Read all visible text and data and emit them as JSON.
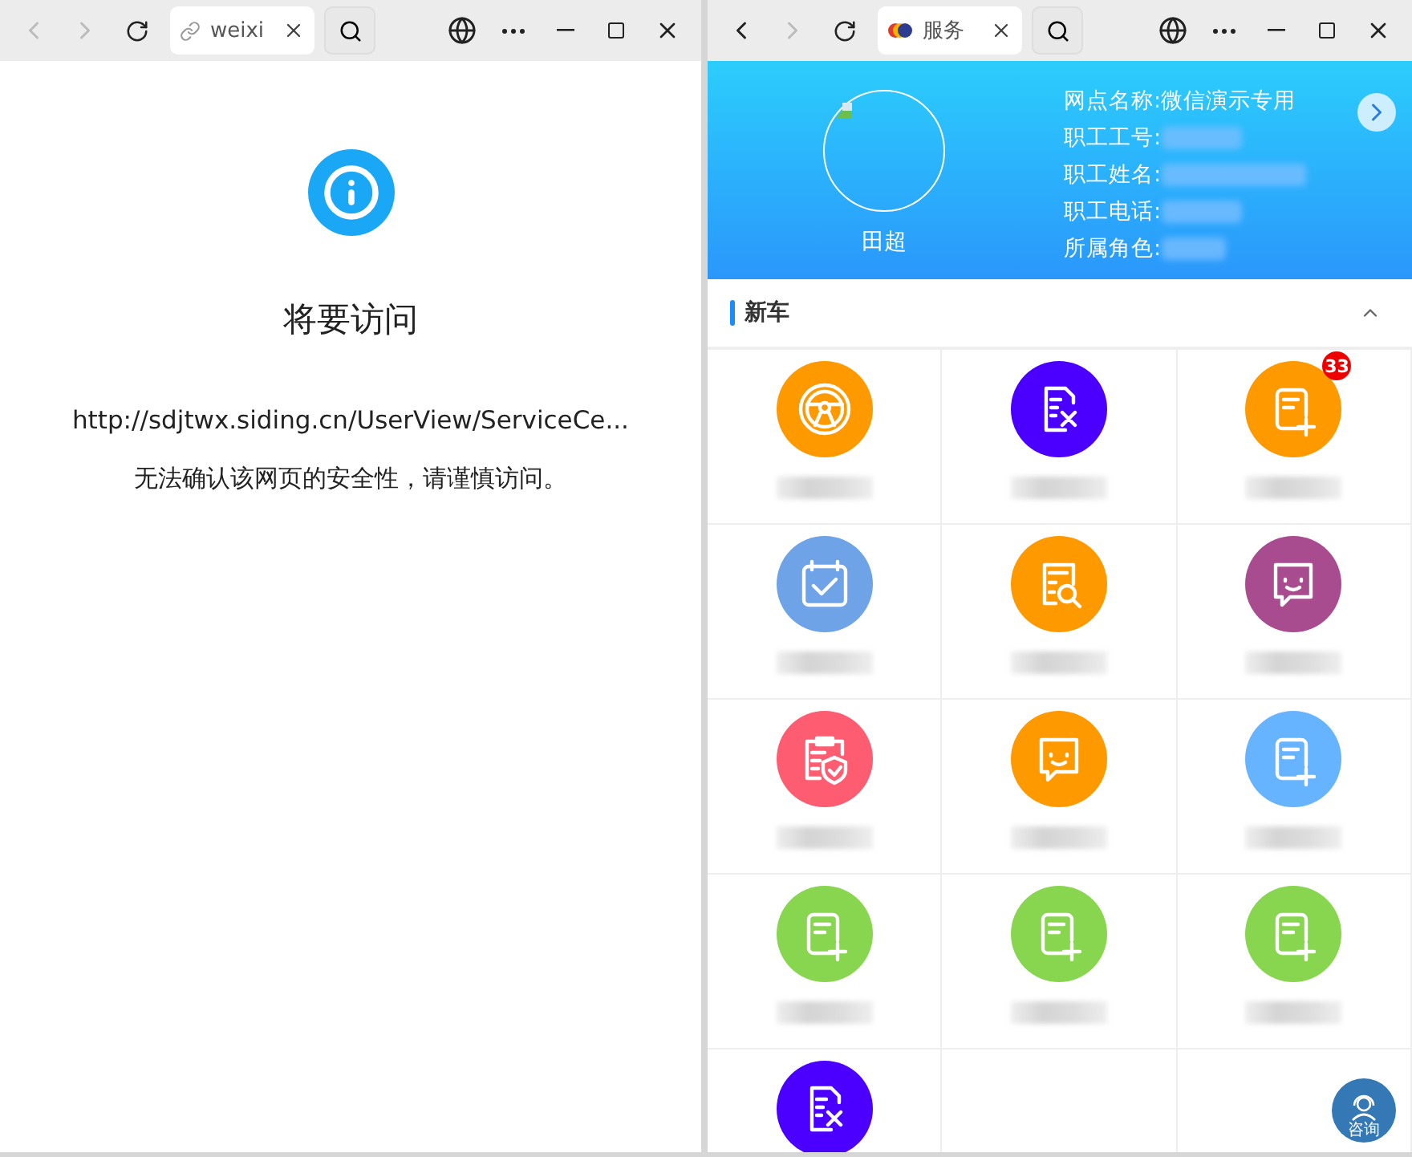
{
  "left_window": {
    "toolbar": {
      "back_enabled": false,
      "tab": {
        "title": "weixi",
        "kind": "link"
      }
    },
    "page": {
      "title": "将要访问",
      "url": "http://sdjtwx.siding.cn/UserView/ServiceCe...",
      "warning": "无法确认该网页的安全性，请谨慎访问。"
    }
  },
  "right_window": {
    "toolbar": {
      "back_enabled": true,
      "tab": {
        "title": "服务",
        "kind": "favicon"
      }
    },
    "profile": {
      "name": "田超",
      "fields": [
        {
          "label": "网点名称:",
          "value": "微信演示专用"
        },
        {
          "label": "职工工号:",
          "redacted": true
        },
        {
          "label": "职工姓名:",
          "redacted": true
        },
        {
          "label": "职工电话:",
          "redacted": true
        },
        {
          "label": "所属角色:",
          "redacted": true
        }
      ]
    },
    "section": {
      "title": "新车",
      "expanded": true
    },
    "tiles": [
      {
        "kind": "wheel",
        "color": "#ff9900",
        "blurred_label": true
      },
      {
        "kind": "doc-tools",
        "color": "#4b00ff",
        "blurred_label": true
      },
      {
        "kind": "doc-plus",
        "color": "#ff9900",
        "badge": "33",
        "blurred_label": true
      },
      {
        "kind": "calendar",
        "color": "#6ea3e8",
        "blurred_label": true
      },
      {
        "kind": "doc-search",
        "color": "#ff9900",
        "blurred_label": true
      },
      {
        "kind": "chat",
        "color": "#a94c8f",
        "blurred_label": true
      },
      {
        "kind": "clipboard-shield",
        "color": "#fe5c70",
        "blurred_label": true
      },
      {
        "kind": "chat",
        "color": "#ff9900",
        "blurred_label": true
      },
      {
        "kind": "doc-plus",
        "color": "#66b3ff",
        "blurred_label": true
      },
      {
        "kind": "doc-plus",
        "color": "#88d64f",
        "blurred_label": true
      },
      {
        "kind": "doc-plus",
        "color": "#88d64f",
        "blurred_label": true
      },
      {
        "kind": "doc-plus",
        "color": "#88d64f",
        "blurred_label": true
      },
      {
        "kind": "doc-tools",
        "color": "#4b00ff"
      }
    ],
    "consult_button": {
      "label": "咨询"
    }
  }
}
